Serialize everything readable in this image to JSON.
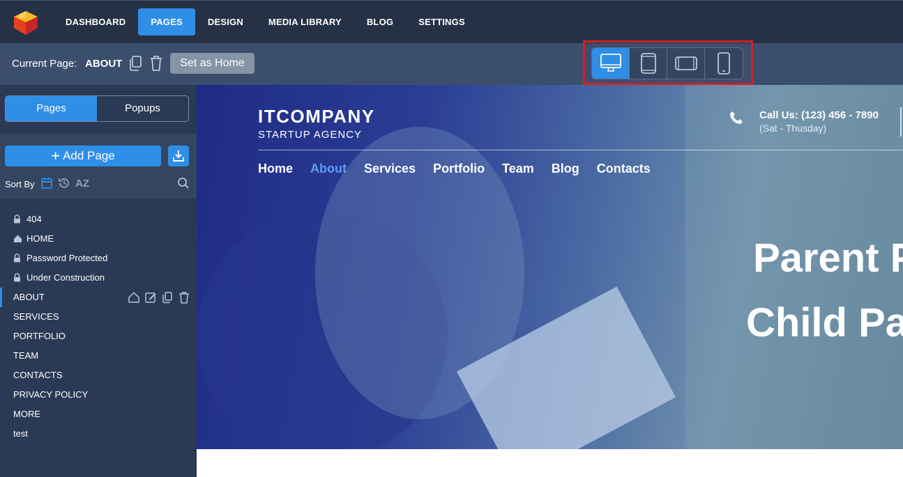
{
  "topnav": {
    "items": [
      {
        "label": "DASHBOARD"
      },
      {
        "label": "PAGES"
      },
      {
        "label": "DESIGN"
      },
      {
        "label": "MEDIA LIBRARY"
      },
      {
        "label": "BLOG"
      },
      {
        "label": "SETTINGS"
      }
    ],
    "active": "PAGES"
  },
  "pagebar": {
    "current_label": "Current Page:",
    "current_name": "ABOUT",
    "set_home_label": "Set as Home",
    "devices": [
      {
        "icon": "desktop-icon",
        "active": true
      },
      {
        "icon": "tablet-portrait-icon",
        "active": false
      },
      {
        "icon": "tablet-landscape-icon",
        "active": false
      },
      {
        "icon": "mobile-icon",
        "active": false
      }
    ]
  },
  "sidebar": {
    "tabs": [
      {
        "label": "Pages"
      },
      {
        "label": "Popups"
      }
    ],
    "add_page_label": "Add Page",
    "sort_label": "Sort By",
    "sort_az": "AZ",
    "pages": [
      {
        "label": "404",
        "icon": "lock-icon"
      },
      {
        "label": "HOME",
        "icon": "home-icon"
      },
      {
        "label": "Password Protected",
        "icon": "lock-icon"
      },
      {
        "label": "Under Construction",
        "icon": "lock-icon"
      },
      {
        "label": "ABOUT",
        "active": true
      },
      {
        "label": "SERVICES"
      },
      {
        "label": "PORTFOLIO"
      },
      {
        "label": "TEAM"
      },
      {
        "label": "CONTACTS"
      },
      {
        "label": "PRIVACY POLICY"
      },
      {
        "label": "MORE"
      },
      {
        "label": "test"
      }
    ]
  },
  "preview": {
    "brand_name": "ITCOMPANY",
    "brand_sub": "STARTUP AGENCY",
    "call_title": "Call Us: (123) 456 - 7890",
    "call_sub": "(Sat - Thusday)",
    "nav": [
      {
        "label": "Home"
      },
      {
        "label": "About"
      },
      {
        "label": "Services"
      },
      {
        "label": "Portfolio"
      },
      {
        "label": "Team"
      },
      {
        "label": "Blog"
      },
      {
        "label": "Contacts"
      }
    ],
    "hero_title1": "Parent P",
    "hero_title2": "Child Pag"
  },
  "colors": {
    "accent": "#2f8ee6",
    "topbar": "#263146",
    "pagebar": "#3b4f6d",
    "sidebar": "#2b3a54",
    "highlight": "#d42025"
  }
}
